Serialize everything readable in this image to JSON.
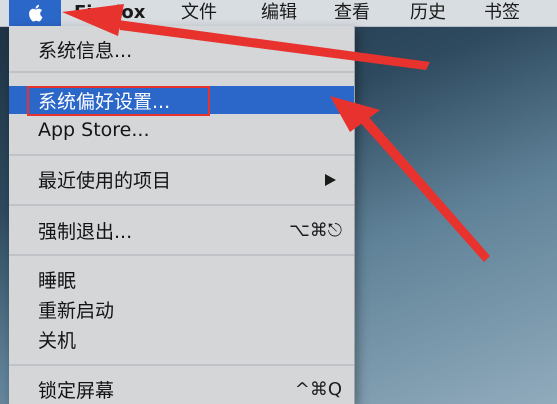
{
  "menubar": {
    "app_name": "Firefox",
    "items": [
      "文件",
      "编辑",
      "查看",
      "历史",
      "书签"
    ]
  },
  "apple_menu": {
    "items": [
      {
        "label": "系统信息..."
      },
      {
        "label": "系统偏好设置...",
        "state": "highlighted"
      },
      {
        "label": "App Store..."
      },
      {
        "label": "最近使用的项目",
        "submenu": true
      },
      {
        "label": "强制退出...",
        "shortcut": "⌥⌘⎋"
      },
      {
        "label": "睡眠"
      },
      {
        "label": "重新启动"
      },
      {
        "label": "关机"
      },
      {
        "label": "锁定屏幕",
        "shortcut": "^⌘Q"
      }
    ]
  },
  "colors": {
    "highlight": "#2b67c9",
    "annotation_red": "#e8322e"
  },
  "icons": {
    "apple_menu": "apple-logo-icon",
    "submenu": "chevron-right-icon"
  }
}
